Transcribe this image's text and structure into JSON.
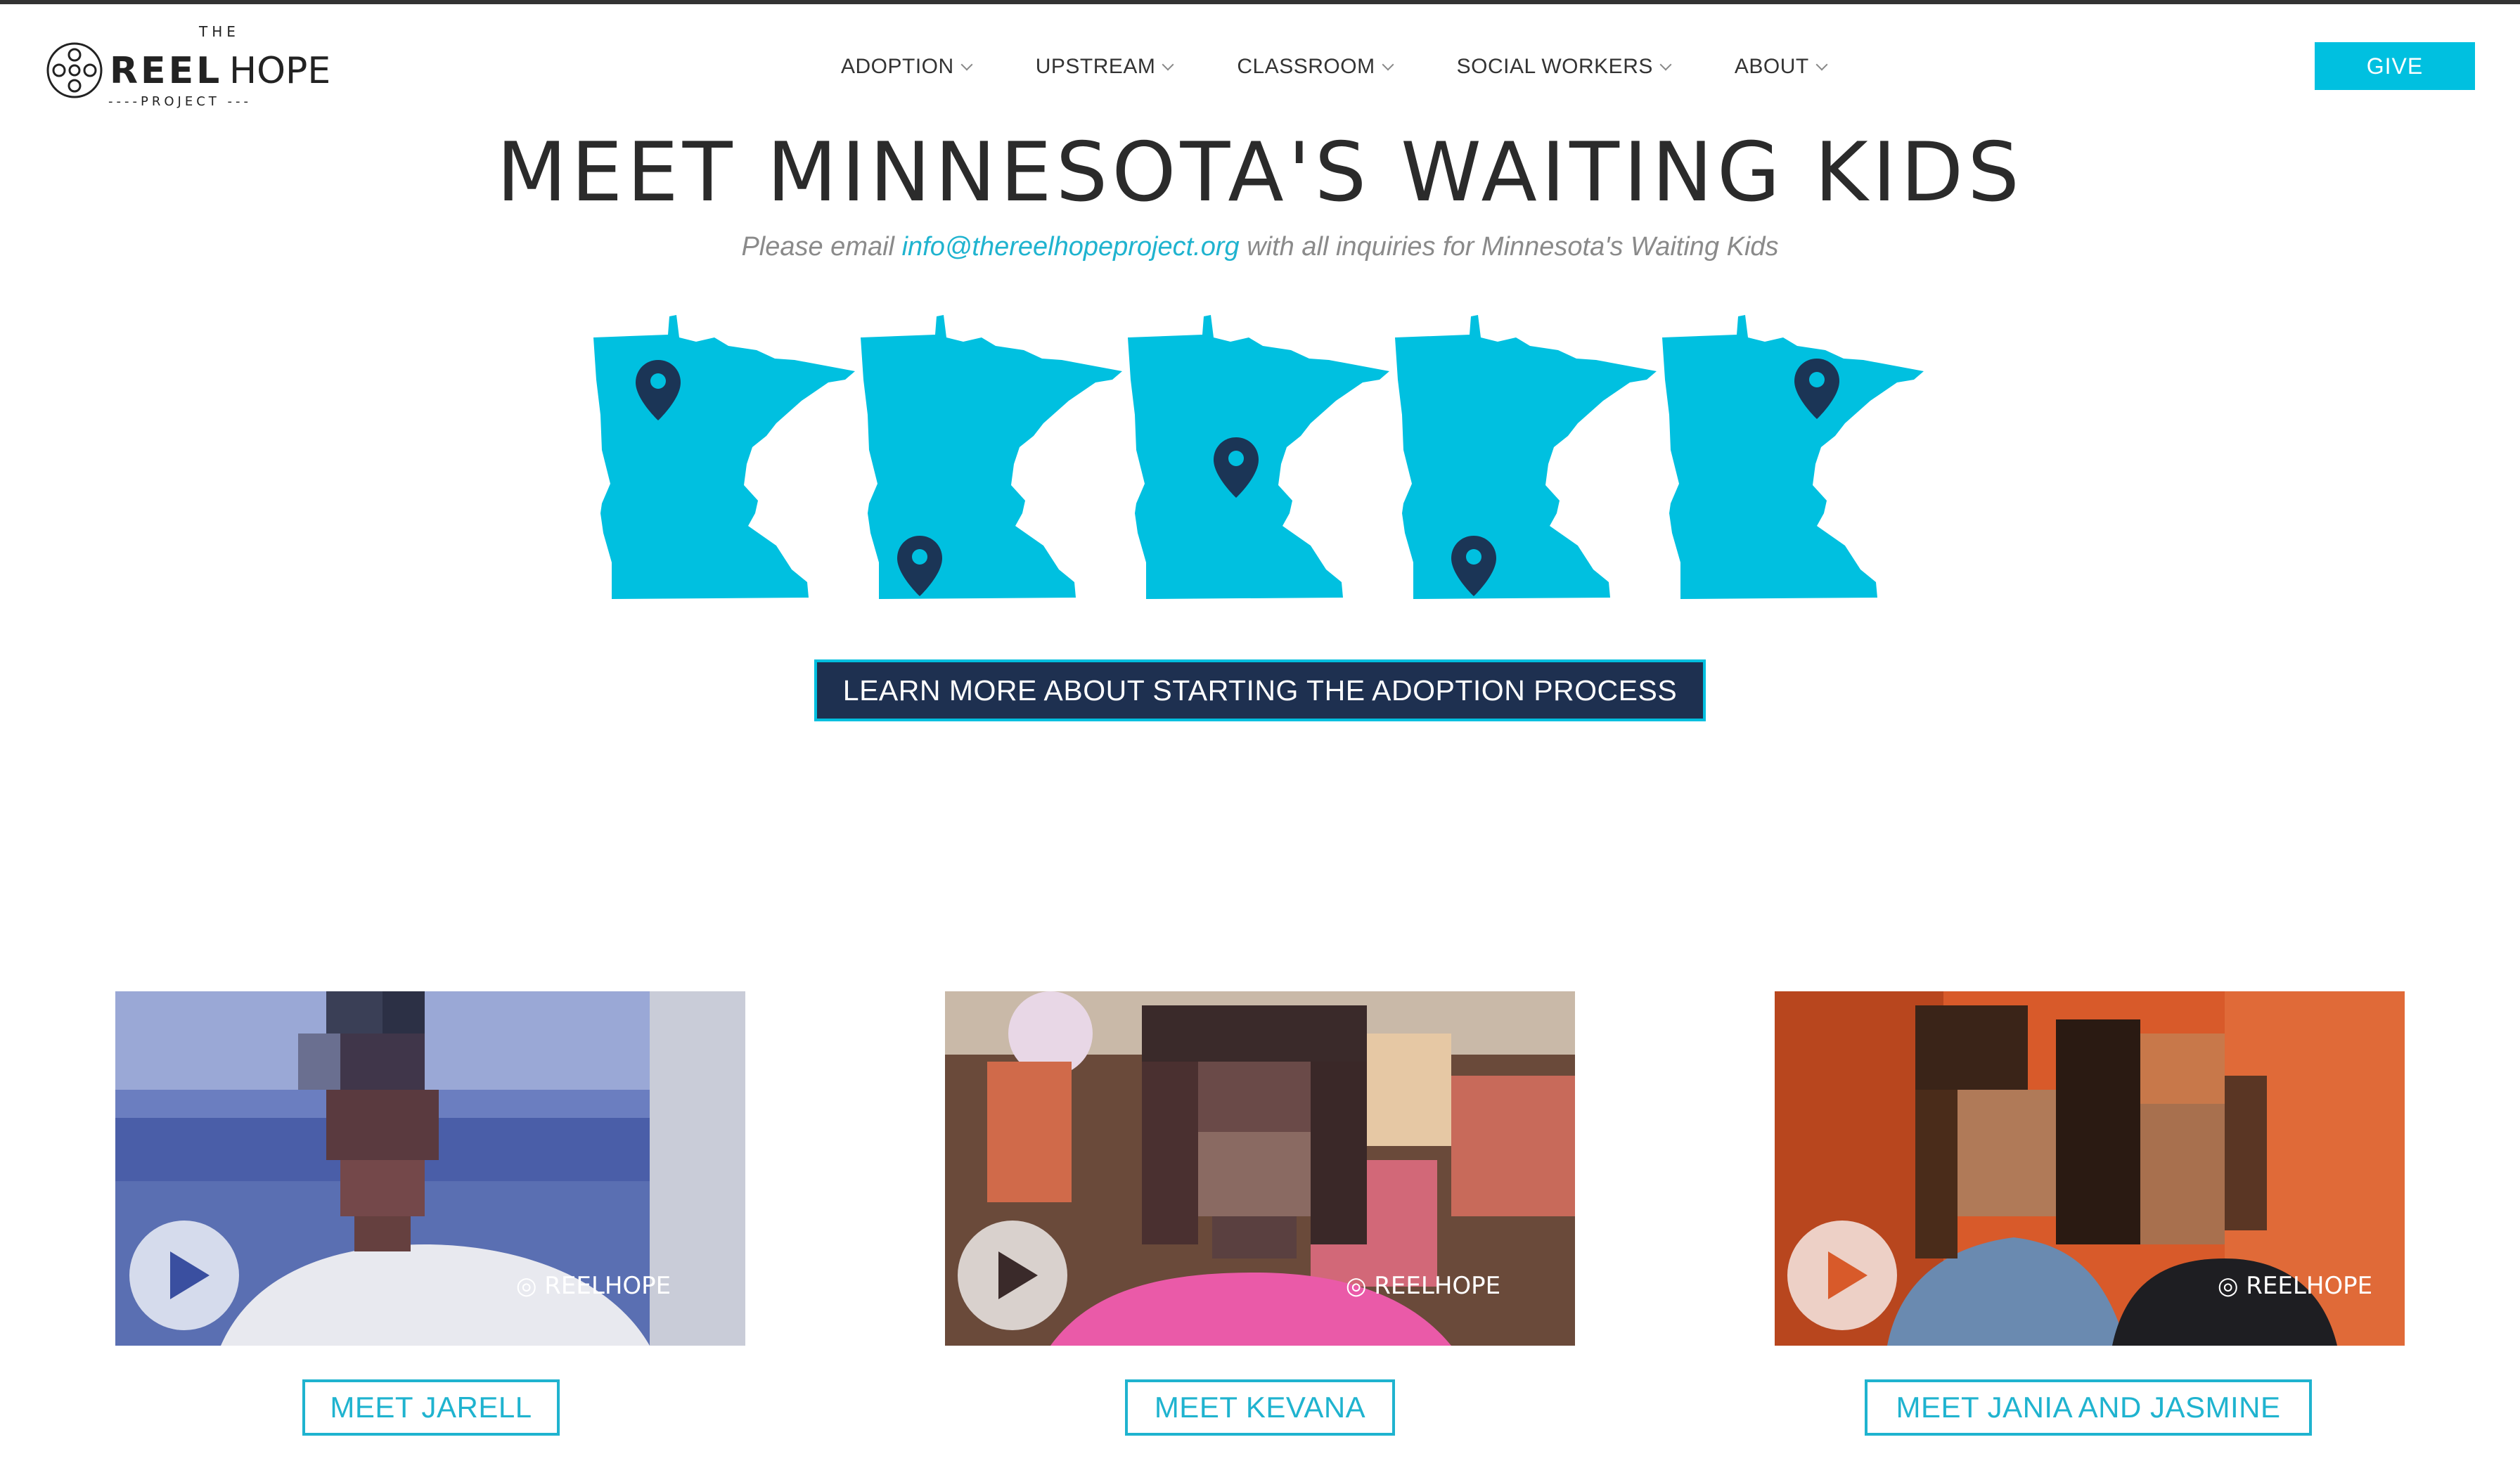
{
  "header": {
    "logo": {
      "top": "THE",
      "word1": "REEL",
      "word2": "HOPE",
      "bottom": "----PROJECT ---"
    },
    "nav": [
      {
        "label": "ADOPTION"
      },
      {
        "label": "UPSTREAM"
      },
      {
        "label": "CLASSROOM"
      },
      {
        "label": "SOCIAL WORKERS"
      },
      {
        "label": "ABOUT"
      }
    ],
    "give_label": "GIVE"
  },
  "main": {
    "title": "MEET MINNESOTA'S WAITING KIDS",
    "subtitle_before": "Please email ",
    "subtitle_email": "info@thereelhopeproject.org",
    "subtitle_after": " with all inquiries for Minnesota's Waiting Kids",
    "learn_more_label": "LEARN MORE ABOUT STARTING THE ADOPTION PROCESS"
  },
  "videos": [
    {
      "button_label": "MEET JARELL"
    },
    {
      "button_label": "MEET KEVANA"
    },
    {
      "button_label": "MEET JANIA AND JASMINE"
    }
  ],
  "colors": {
    "accent": "#00c0e0",
    "navy": "#1e3050",
    "pin": "#1b3556",
    "text": "#333333"
  },
  "icons": {
    "map_pin": "map-pin-icon",
    "play": "play-icon",
    "nav_chevron": "chevron-down-icon"
  }
}
